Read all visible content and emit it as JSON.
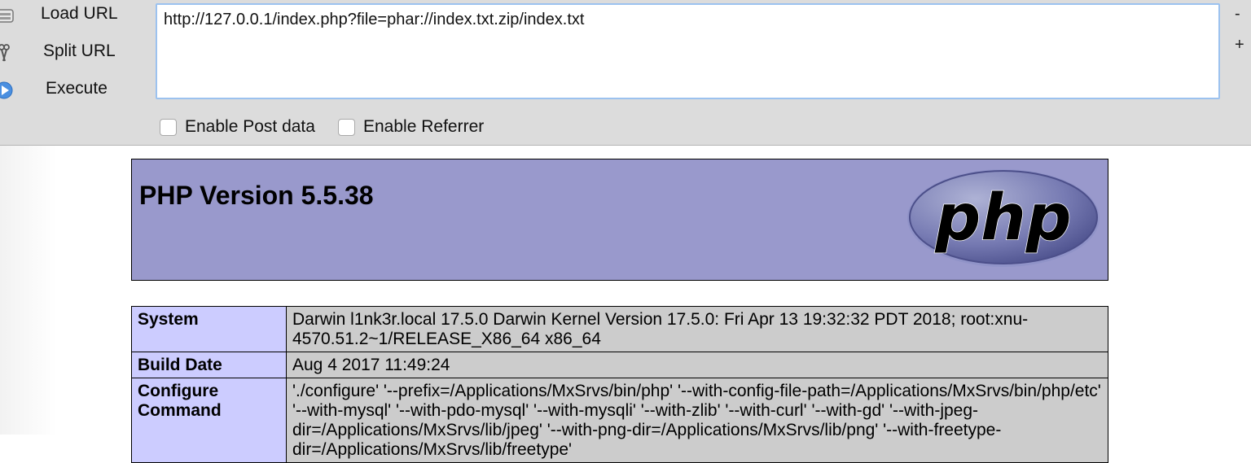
{
  "hackbar": {
    "buttons": [
      {
        "label": "Load URL",
        "icon": "load-url-icon"
      },
      {
        "label": "Split URL",
        "icon": "split-url-icon"
      },
      {
        "label": "Execute",
        "icon": "execute-icon"
      }
    ],
    "url_value": "http://127.0.0.1/index.php?file=phar://index.txt.zip/index.txt",
    "minus_label": "-",
    "plus_label": "+",
    "post_data_label": "Enable Post data",
    "post_data_checked": false,
    "referrer_label": "Enable Referrer",
    "referrer_checked": false,
    "colors": {
      "toolbar_bg": "#dcdcdc",
      "focus_border": "#9cc2ef"
    }
  },
  "phpinfo": {
    "title": "PHP Version 5.5.38",
    "logo_text": "php",
    "colors": {
      "header_bg": "#9999cc",
      "key_bg": "#ccccff",
      "value_bg": "#cccccc"
    },
    "rows": [
      {
        "key": "System",
        "value": "Darwin l1nk3r.local 17.5.0 Darwin Kernel Version 17.5.0: Fri Apr 13 19:32:32 PDT 2018; root:xnu-4570.51.2~1/RELEASE_X86_64 x86_64"
      },
      {
        "key": "Build Date",
        "value": "Aug 4 2017 11:49:24"
      },
      {
        "key": "Configure Command",
        "value": "'./configure' '--prefix=/Applications/MxSrvs/bin/php' '--with-config-file-path=/Applications/MxSrvs/bin/php/etc' '--with-mysql' '--with-pdo-mysql' '--with-mysqli' '--with-zlib' '--with-curl' '--with-gd' '--with-jpeg-dir=/Applications/MxSrvs/lib/jpeg' '--with-png-dir=/Applications/MxSrvs/lib/png' '--with-freetype-dir=/Applications/MxSrvs/lib/freetype'"
      }
    ]
  }
}
